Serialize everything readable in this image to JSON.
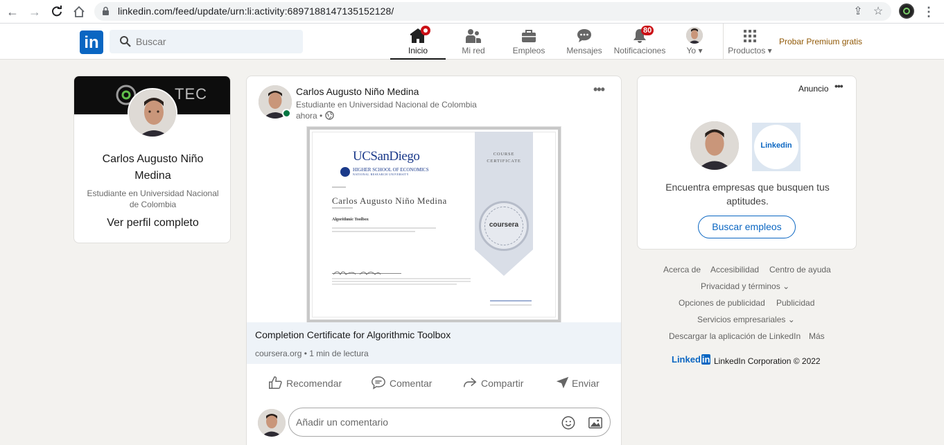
{
  "browser": {
    "url": "linkedin.com/feed/update/urn:li:activity:6897188147135152128/"
  },
  "nav": {
    "logo": "in",
    "search_placeholder": "Buscar",
    "items": [
      {
        "label": "Inicio"
      },
      {
        "label": "Mi red"
      },
      {
        "label": "Empleos"
      },
      {
        "label": "Mensajes"
      },
      {
        "label": "Notificaciones",
        "badge": "80"
      },
      {
        "label": "Yo"
      },
      {
        "label": "Productos"
      }
    ],
    "premium": "Probar Premium gratis"
  },
  "profile_card": {
    "banner_text": "TEC",
    "name": "Carlos Augusto Niño Medina",
    "headline": "Estudiante en Universidad Nacional de Colombia",
    "view_profile": "Ver perfil completo"
  },
  "post": {
    "author": "Carlos Augusto Niño Medina",
    "headline": "Estudiante en Universidad Nacional de Colombia",
    "time": "ahora •",
    "certificate": {
      "org": "UCSanDiego",
      "org2": "HIGHER SCHOOL OF ECONOMICS",
      "org3": "NATIONAL RESEARCH UNIVERSITY",
      "ribbon": "COURSE CERTIFICATE",
      "recipient": "Carlos Augusto Niño Medina",
      "course": "Algorithmic Toolbox",
      "seal": "coursera"
    },
    "link_title": "Completion Certificate for Algorithmic Toolbox",
    "link_source": "coursera.org • 1 min de lectura",
    "actions": [
      "Recomendar",
      "Comentar",
      "Compartir",
      "Enviar"
    ],
    "comment_placeholder": "Añadir un comentario"
  },
  "ad": {
    "label": "Anuncio",
    "logo_text": "Linkedin",
    "text": "Encuentra empresas que busquen tus aptitudes.",
    "button": "Buscar empleos"
  },
  "footer": {
    "links": [
      "Acerca de",
      "Accesibilidad",
      "Centro de ayuda",
      "Privacidad y términos",
      "Opciones de publicidad",
      "Publicidad",
      "Servicios empresariales",
      "Descargar la aplicación de LinkedIn",
      "Más"
    ],
    "brand": "Linked",
    "brand_in": "in",
    "copyright": "LinkedIn Corporation © 2022"
  },
  "colors": {
    "brand": "#0a66c2",
    "background": "#f3f2ef",
    "badge": "#cc1016",
    "online": "#057642"
  }
}
